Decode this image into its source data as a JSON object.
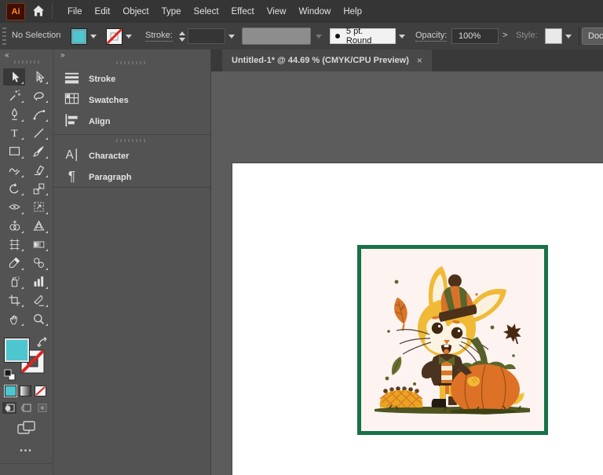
{
  "app": {
    "name": "Adobe Illustrator",
    "logo_text": "Ai"
  },
  "menu_bar": {
    "items": [
      "File",
      "Edit",
      "Object",
      "Type",
      "Select",
      "Effect",
      "View",
      "Window",
      "Help"
    ]
  },
  "control_bar": {
    "selection_status": "No Selection",
    "fill_color": "#4dc6cf",
    "stroke_is_none": true,
    "stroke_label": "Stroke:",
    "brush_label": "5 pt. Round",
    "opacity_label": "Opacity:",
    "opacity_value": "100%",
    "opacity_expand_glyph": ">",
    "style_label": "Style:",
    "document_setup_label": "Docume"
  },
  "document": {
    "tab_title": "Untitled-1* @ 44.69 % (CMYK/CPU Preview)",
    "tab_close_glyph": "×"
  },
  "toolbar": {
    "collapse_glyph": "«",
    "overflow_glyph": "•••",
    "fill_color": "#4dc6cf",
    "tools": [
      {
        "name": "selection",
        "selected": true
      },
      {
        "name": "direct-selection"
      },
      {
        "name": "magic-wand"
      },
      {
        "name": "lasso"
      },
      {
        "name": "pen"
      },
      {
        "name": "curvature"
      },
      {
        "name": "type"
      },
      {
        "name": "line-segment"
      },
      {
        "name": "rectangle"
      },
      {
        "name": "paintbrush"
      },
      {
        "name": "shaper"
      },
      {
        "name": "eraser"
      },
      {
        "name": "rotate"
      },
      {
        "name": "scale"
      },
      {
        "name": "width"
      },
      {
        "name": "free-transform"
      },
      {
        "name": "shape-builder"
      },
      {
        "name": "perspective-grid"
      },
      {
        "name": "mesh"
      },
      {
        "name": "gradient"
      },
      {
        "name": "eyedropper"
      },
      {
        "name": "blend"
      },
      {
        "name": "symbol-sprayer"
      },
      {
        "name": "column-graph"
      },
      {
        "name": "artboard"
      },
      {
        "name": "slice"
      },
      {
        "name": "hand"
      },
      {
        "name": "zoom"
      }
    ]
  },
  "panel_dock": {
    "collapse_glyph": "»",
    "groups": [
      {
        "items": [
          {
            "icon": "stroke-icon",
            "label": "Stroke"
          },
          {
            "icon": "swatches-icon",
            "label": "Swatches"
          },
          {
            "icon": "align-icon",
            "label": "Align"
          }
        ]
      },
      {
        "items": [
          {
            "icon": "character-icon",
            "label": "Character"
          },
          {
            "icon": "paragraph-icon",
            "label": "Paragraph"
          }
        ]
      }
    ]
  },
  "artwork": {
    "description": "Autumn illustration: yellow bunny wearing an orange-and-olive striped beanie with brown pom-pom and a brown jacket, standing beside a large orange pumpkin, with falling leaves, an acorn basket and grass, inside a dark green square frame on a pale pink background",
    "frame_color": "#177248",
    "background_color": "#fdf3f0",
    "palette": {
      "bunny_yellow": "#f0ba36",
      "pumpkin_orange": "#dd7226",
      "olive_green": "#5d652a",
      "dark_brown": "#4a3420",
      "cream": "#fcf3e2",
      "leaf_orange": "#d8772a"
    }
  }
}
